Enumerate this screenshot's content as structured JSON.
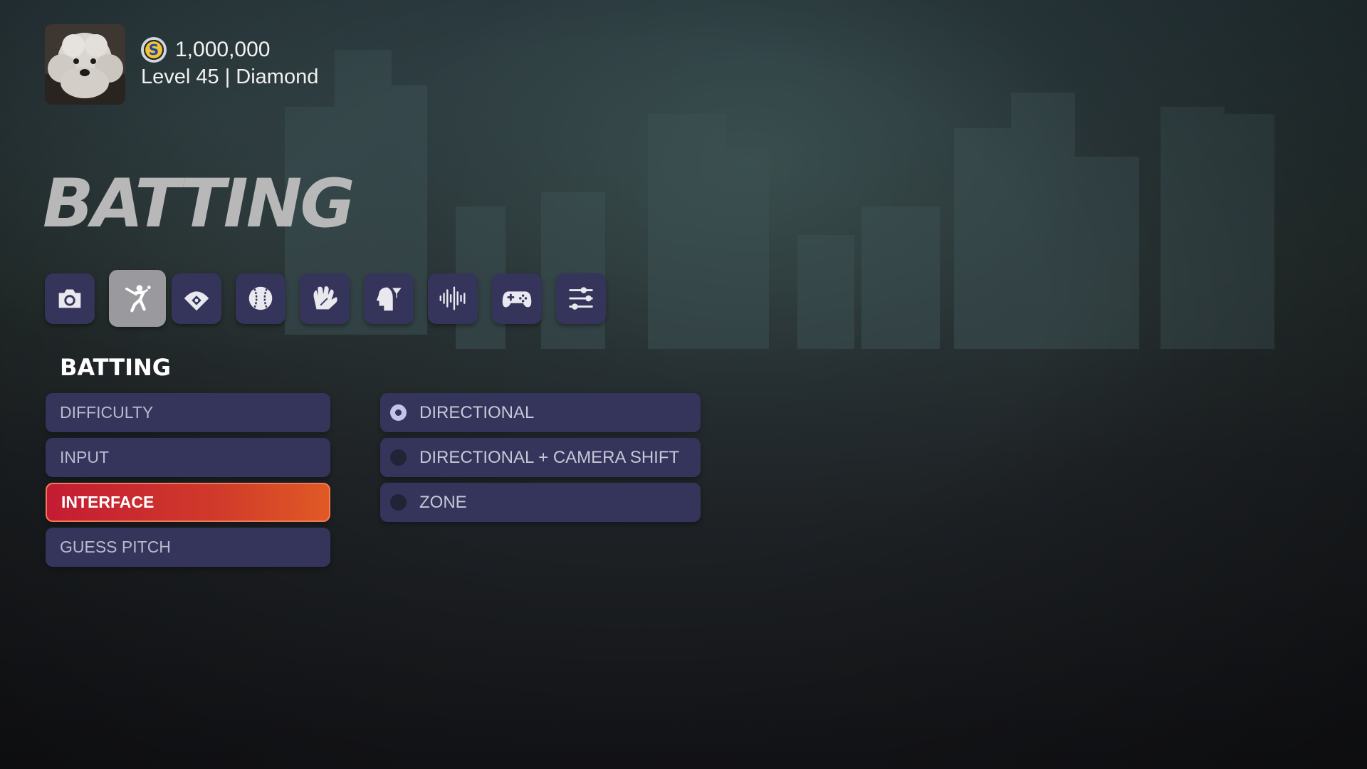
{
  "profile": {
    "coins": "1,000,000",
    "coin_icon": "S",
    "level_text": "Level 45 | Diamond",
    "avatar": "dog-avatar"
  },
  "page_title": "BATTING",
  "categories": [
    {
      "icon": "camera-icon",
      "active": false
    },
    {
      "icon": "batter-icon",
      "active": true
    },
    {
      "icon": "baseball-diamond-icon",
      "active": false
    },
    {
      "icon": "baseball-icon",
      "active": false
    },
    {
      "icon": "glove-icon",
      "active": false
    },
    {
      "icon": "head-filter-icon",
      "active": false
    },
    {
      "icon": "audio-wave-icon",
      "active": false
    },
    {
      "icon": "gamepad-icon",
      "active": false
    },
    {
      "icon": "sliders-icon",
      "active": false
    }
  ],
  "section_title": "BATTING",
  "menu": [
    {
      "label": "DIFFICULTY",
      "selected": false
    },
    {
      "label": "INPUT",
      "selected": false
    },
    {
      "label": "INTERFACE",
      "selected": true
    },
    {
      "label": "GUESS PITCH",
      "selected": false
    }
  ],
  "options": [
    {
      "label": "DIRECTIONAL",
      "checked": true
    },
    {
      "label": "DIRECTIONAL + CAMERA SHIFT",
      "checked": false
    },
    {
      "label": "ZONE",
      "checked": false
    }
  ],
  "colors": {
    "panel": "#35345a",
    "selected_gradient_start": "#c41c33",
    "selected_gradient_end": "#e05a25",
    "active_category": "#9a9a9e",
    "title": "#b8b8b8"
  }
}
